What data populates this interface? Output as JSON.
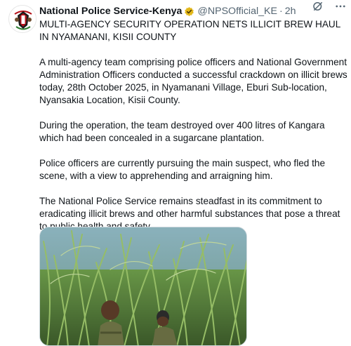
{
  "post": {
    "author_name": "National Police Service-Kenya",
    "handle": "@NPSOfficial_KE",
    "separator": "·",
    "time": "2h",
    "avatar_icon": "police-crest-icon",
    "verified_icon": "gold-check-badge-icon",
    "verified_color": "#e2b719",
    "grok_icon": "grok-icon",
    "more_icon": "more-icon",
    "paragraphs": [
      "MULTI-AGENCY SECURITY OPERATION NETS ILLICIT BREW HAUL IN NYAMANANI, KISII COUNTY",
      "A multi-agency team comprising police officers and National Government Administration Officers conducted a successful crackdown on illicit brews today, 28th October 2025, in Nyamanani Village, Eburi Sub-location, Nyansakia Location, Kisii County.",
      "During the operation, the team destroyed over 400 litres of Kangara which had been concealed in a sugarcane plantation.",
      "Police officers are currently pursuing the main suspect, who fled the scene, with a view to apprehending and arraigning him.",
      "The National Police Service remains steadfast in its commitment to eradicating illicit brews and other harmful substances that pose a threat to public health and safety."
    ],
    "media": {
      "type": "photo",
      "subject": "officers-in-sugarcane-plantation-photo"
    }
  },
  "colors": {
    "text_primary": "#0f1419",
    "text_secondary": "#536471",
    "border": "#cfd9de"
  }
}
